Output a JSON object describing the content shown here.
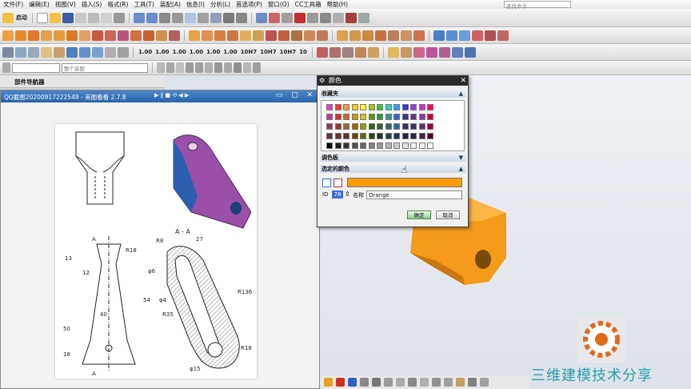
{
  "menu": [
    "文件(F)",
    "编辑(E)",
    "视图(V)",
    "插入(S)",
    "格式(R)",
    "工具(T)",
    "装配(A)",
    "信息(I)",
    "分析(L)",
    "首选项(P)",
    "窗口(O)",
    "CC工具箱",
    "帮助(H)"
  ],
  "search_placeholder": "查找命令",
  "start_label": "启动",
  "toolbar4_dropdown": "整个装配",
  "toolbar3_labels": [
    "1.00",
    "1.00",
    "1.00",
    "1.00",
    "1.00",
    "1.00",
    "10H7",
    "10H7",
    "10H7",
    "10"
  ],
  "navigator": {
    "title": "部件导航器"
  },
  "player": {
    "title": "QQ截图20200917222549 - 美图看看 2.7.8",
    "controls": "▶ ‖ ■ ⟲ ◀ ▶"
  },
  "drawing": {
    "label_aa": "A - A",
    "dims": [
      "27",
      "R8",
      "13",
      "R18",
      "12",
      "54",
      "R136",
      "R35",
      "40",
      "50",
      "18",
      "φ15",
      "φ6",
      "φ4",
      "R18",
      "A",
      "A"
    ]
  },
  "dialog": {
    "title": "颜色",
    "favorites": "收藏夹",
    "palette": "调色板",
    "selected_color": "选定的颜色",
    "id_label": "ID",
    "id_value": "78",
    "name_label": "名称",
    "name_value": "Orange",
    "ok": "确定",
    "cancel": "取消"
  },
  "palette_colors": [
    [
      "#ff33cc",
      "#ff3333",
      "#ff9933",
      "#ffcc00",
      "#ffff00",
      "#99cc00",
      "#33cc33",
      "#33cccc",
      "#3399ff",
      "#3333ff",
      "#9933ff",
      "#cc33cc",
      "#ff0066"
    ],
    [
      "#cc3399",
      "#cc3333",
      "#cc6633",
      "#cc9900",
      "#cccc00",
      "#669900",
      "#339933",
      "#339999",
      "#3366cc",
      "#333399",
      "#663399",
      "#993399",
      "#cc0033"
    ],
    [
      "#993366",
      "#993333",
      "#996633",
      "#996600",
      "#999900",
      "#336600",
      "#336633",
      "#336666",
      "#336699",
      "#333366",
      "#333366",
      "#663366",
      "#990033"
    ],
    [
      "#663344",
      "#663333",
      "#663322",
      "#664400",
      "#666600",
      "#334400",
      "#223322",
      "#224444",
      "#223355",
      "#222244",
      "#332244",
      "#442244",
      "#550022"
    ],
    [
      "#000000",
      "#1c1c1c",
      "#333333",
      "#4d4d4d",
      "#666666",
      "#808080",
      "#999999",
      "#b3b3b3",
      "#cccccc",
      "#e0e0e0",
      "#eeeeee",
      "#f8f8f8",
      "#ffffff"
    ]
  ],
  "selected_color_hex": "#ff9a00",
  "watermark": "三维建模技术分享"
}
